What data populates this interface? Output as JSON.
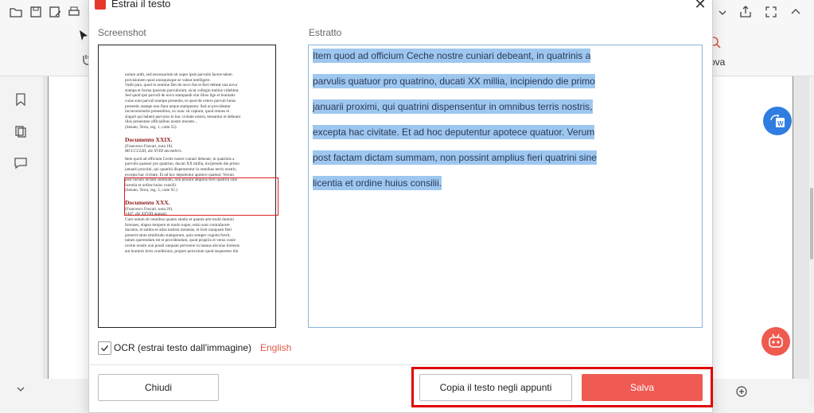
{
  "dialog": {
    "title": "Estrai il testo",
    "screenshot_label": "Screenshot",
    "extracted_label": "Estratto",
    "extracted_lines": [
      "Item quod ad officium Ceche nostre cuniari debeant, in quatrinis a",
      "parvulis quatuor pro quatrino, ducati XX millia, incipiendo die primo",
      "januarii proximi, qui quatrini dispensentur in omnibus terris nostris,",
      "excepta hac civitate. Et ad hoc deputentur apotece quatuor. Verum",
      "post factam dictam summam, non possint amplius fieri quatrini sine",
      "licentia et ordine huius consilii."
    ],
    "ocr_label": "OCR (estrai testo dall'immagine)",
    "ocr_checked": true,
    "ocr_language": "English",
    "buttons": {
      "close": "Chiudi",
      "copy": "Copia il testo negli appunti",
      "save": "Salva"
    }
  },
  "preview": {
    "block1": [
      "nolum ardit, sed necessarium sit super ipsis parvulis facere talem",
      "provisionem quod unusquisque se valeat intelligere.",
      "Vadit pars, quod in nomine Dei de novo fiat et fieri debeat una nova",
      "stampa et forma ipsorum parvulorum, sicut collegio melius videbitur.",
      "Sed quod ipsi parvuli de novo stampandi sint illius lige et bonitatis",
      "cuius sunt parvuli stampe presentis, et quod de cetero parvuli huius",
      "presentis stampe non fiant neque stampentur. Sed ut provideatur",
      "inconvenientiis presentibus, ex nunc sit captum, quod omnes et",
      "singuli qui habent parvulos in hac civitate nostra, teneantur et debeant",
      "illos presentare officialibus nostre monete...",
      "(Senato, Terra, reg. 1, carte 55)."
    ],
    "head1": "Documento XXIX.",
    "sub1": "(Francesco Foscari, nota 18).",
    "date1": "MCCCCLIII, die XVIII decembris.",
    "block2": [
      "Item quod ad officium Ceche nostre cuniari debeant, in quatrinis a",
      "parvulis quatuor pro quatrino, ducati XX millia, incipiendo die primo",
      "januarii proximi, qui quatrini dispensentur in omnibus terris nostris,",
      "excepta hac civitate. Et ad hoc deputentur apotece quatuor. Verum",
      "post factam dictam summam, non possint amplius fieri quatrini sine",
      "licentia et ordine huius consilii."
    ],
    "note2": "(Senato, Terra, reg. 3, carte 92.)",
    "head2": "Documento XXX.",
    "sub2": "(Francesco Foscari, nota 26).",
    "date2": "1447, die XXVIII augusti.",
    "block3": [
      "Cum notum sit omnibus quanto studio et quanta arte multi domini",
      "forenses, elapso tempore et modo nuper, enisi sunt contrafacere",
      "ducatos, et soldos et alias nostras monetas, et licet nunquam fieri",
      "potuerit tanta similitudo stamparum, quin semper cognita fuerit,",
      "tamen querendum est et providendum, quod propriis et verus cunie",
      "cechie nostre non possit unquam pervenire in manus alicuius forensis",
      "aut hominis levis conditionis, propter periculum quod sequeretur illo"
    ]
  },
  "background": {
    "nuova_label": "ova"
  },
  "colors": {
    "accent": "#ef5a53",
    "highlight": "#9ec7f0",
    "frame": "#e00000",
    "link": "#e25a4a"
  }
}
